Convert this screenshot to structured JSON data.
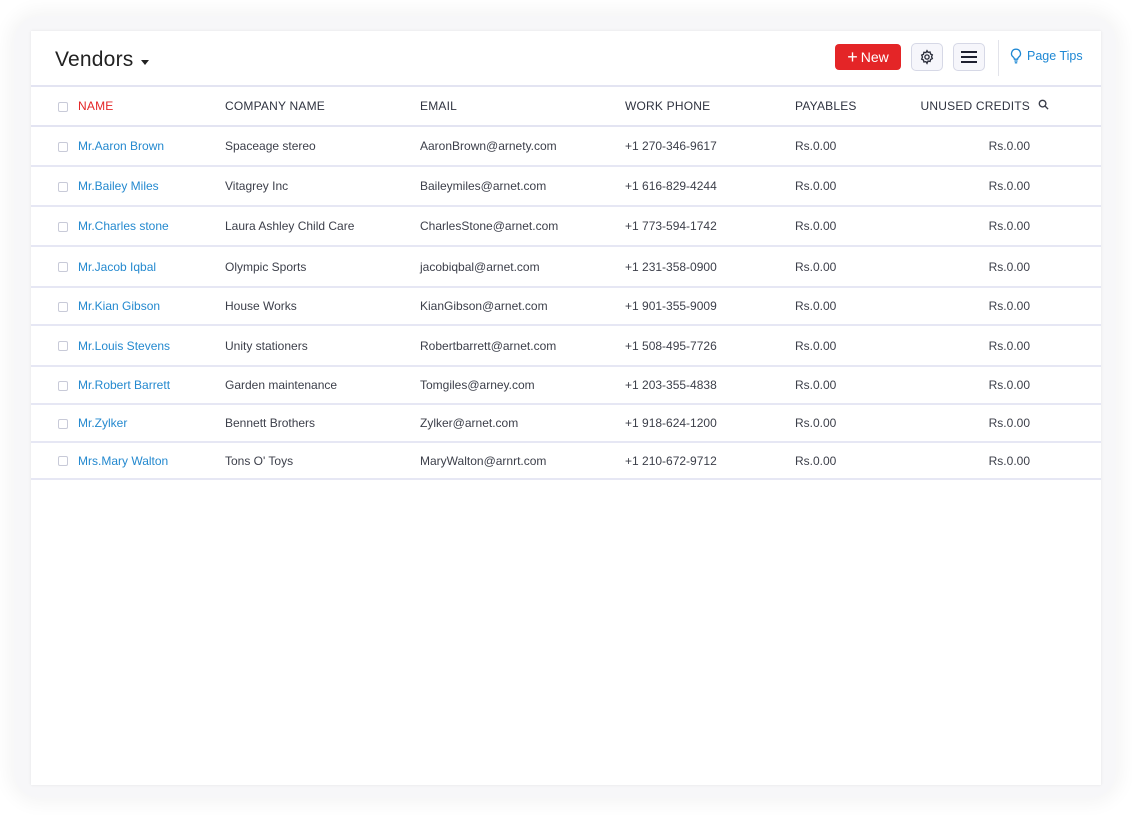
{
  "header": {
    "title": "Vendors",
    "new_label": "New",
    "tips_label": "Page Tips"
  },
  "table": {
    "columns": {
      "name": "NAME",
      "company": "COMPANY NAME",
      "email": "EMAIL",
      "phone": "WORK PHONE",
      "payables": "PAYABLES",
      "unused": "UNUSED CREDITS"
    },
    "rows": [
      {
        "name": "Mr.Aaron Brown",
        "company": "Spaceage stereo",
        "email": "AaronBrown@arnety.com",
        "phone": "+1 270-346-9617",
        "payables": "Rs.0.00",
        "unused": "Rs.0.00"
      },
      {
        "name": "Mr.Bailey Miles",
        "company": "Vitagrey Inc",
        "email": "Baileymiles@arnet.com",
        "phone": "+1 616-829-4244",
        "payables": "Rs.0.00",
        "unused": "Rs.0.00"
      },
      {
        "name": "Mr.Charles stone",
        "company": "Laura Ashley Child Care",
        "email": "CharlesStone@arnet.com",
        "phone": "+1 773-594-1742",
        "payables": "Rs.0.00",
        "unused": "Rs.0.00"
      },
      {
        "name": "Mr.Jacob Iqbal",
        "company": "Olympic Sports",
        "email": "jacobiqbal@arnet.com",
        "phone": "+1 231-358-0900",
        "payables": "Rs.0.00",
        "unused": "Rs.0.00"
      },
      {
        "name": "Mr.Kian Gibson",
        "company": "House Works",
        "email": "KianGibson@arnet.com",
        "phone": "+1 901-355-9009",
        "payables": "Rs.0.00",
        "unused": "Rs.0.00"
      },
      {
        "name": "Mr.Louis Stevens",
        "company": "Unity stationers",
        "email": "Robertbarrett@arnet.com",
        "phone": "+1 508-495-7726",
        "payables": "Rs.0.00",
        "unused": "Rs.0.00"
      },
      {
        "name": "Mr.Robert Barrett",
        "company": "Garden maintenance",
        "email": "Tomgiles@arney.com",
        "phone": "+1 203-355-4838",
        "payables": "Rs.0.00",
        "unused": "Rs.0.00"
      },
      {
        "name": "Mr.Zylker",
        "company": "Bennett Brothers",
        "email": "Zylker@arnet.com",
        "phone": "+1 918-624-1200",
        "payables": "Rs.0.00",
        "unused": "Rs.0.00"
      },
      {
        "name": "Mrs.Mary Walton",
        "company": "Tons O' Toys",
        "email": "MaryWalton@arnrt.com",
        "phone": "+1 210-672-9712",
        "payables": "Rs.0.00",
        "unused": "Rs.0.00"
      }
    ]
  },
  "colors": {
    "accent_red": "#e42527",
    "link_blue": "#2489cf",
    "divider": "#e3e4f2"
  },
  "icons": {
    "settings": "gear-icon",
    "menu": "hamburger-icon",
    "tips": "lightbulb-icon",
    "dropdown": "caret-down-icon",
    "search": "search-icon",
    "new": "plus-icon"
  }
}
